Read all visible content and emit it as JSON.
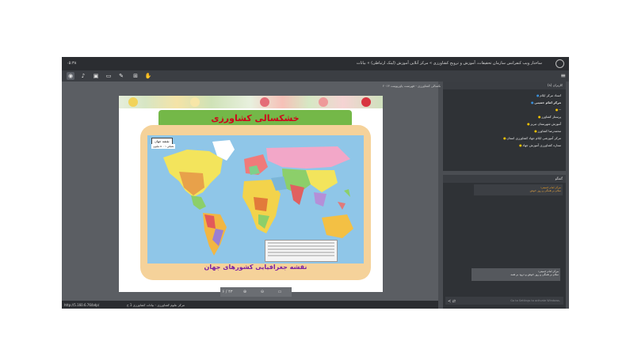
{
  "titlebar": {
    "title": "ساختار ویب کنفرانس سازمان تحقیقات، آموزش و ترویج کشاورزی » مرکز آنلاین آموزش (لینک ارتباطی) » بیانات",
    "clock": "۰۵:۳۸"
  },
  "toolbar": {
    "tools": [
      "mic-icon",
      "speaker-icon",
      "camera-icon",
      "screen-icon",
      "pen-icon",
      "upload-icon",
      "hand-icon"
    ]
  },
  "document": {
    "tab_title": "خشکسالی کشاورزی - فهرست پاورپوینت ۲۰۱۳",
    "slide_title": "خشکسالی کشاورزی",
    "map_box_title": "نقشه جهان",
    "map_scale": "مقیاس ۱ : ۵۰ میلیون",
    "map_caption": "نقشه جغرافیایی کشورهای جهان",
    "page_indicator": "۶ / ۴۳"
  },
  "status": {
    "url": "http://5.160.6.76/bdp/",
    "doc": "مرکز علوم کشاورزی - بیانات کشاورزی 1 ح"
  },
  "users": {
    "header": "کاربران (۸)",
    "list": [
      {
        "name": "استاد مرکز ایلام",
        "type": "host"
      },
      {
        "name": "مرکز امام خمینی",
        "type": "host",
        "bold": true
      },
      {
        "name": "--",
        "type": "user"
      },
      {
        "name": "پرستار کشاورز",
        "type": "user"
      },
      {
        "name": "آموزش شهرستان تبریز",
        "type": "user"
      },
      {
        "name": "محمدرضا کشاورز",
        "type": "user"
      },
      {
        "name": "مرکز آموزشی ایلام جهاد کشاورزی استان",
        "type": "user"
      },
      {
        "name": "ستاره کشاورزی آموزش جهاد",
        "type": "user"
      }
    ]
  },
  "chat": {
    "header": "گفتگو",
    "message1_sender": "مرکز امام خمینی:",
    "message1_text": "سلام بر همگی و روز خوش",
    "message2_sender": "مرکز امام خمینی:",
    "message2_text": "سلام بر همگی و روز خوش و درود بر همه",
    "input_placeholder": "Go to Settings to activate Windows."
  }
}
